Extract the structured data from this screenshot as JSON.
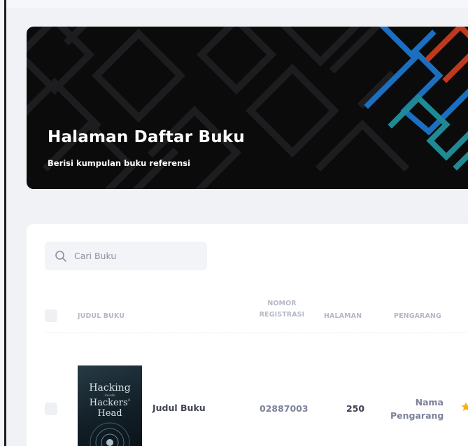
{
  "hero": {
    "title": "Halaman Daftar Buku",
    "subtitle": "Berisi kumpulan buku referensi",
    "accent_colors": [
      "#1c6fc0",
      "#c0391c",
      "#1f8a95"
    ]
  },
  "search": {
    "placeholder": "Cari Buku",
    "value": ""
  },
  "table": {
    "headers": {
      "title": "JUDUL BUKU",
      "registration_line1": "NOMOR",
      "registration_line2": "REGISTRASI",
      "pages": "HALAMAN",
      "author": "PENGARANG"
    },
    "rows": [
      {
        "cover_line1": "Hacking",
        "cover_line2": "Hackers' Head",
        "cover_small": "inside",
        "title": "Judul Buku",
        "registration": "02887003",
        "pages": "250",
        "author_line1": "Nama",
        "author_line2": "Pengarang",
        "rating_icon": "star-icon",
        "rating_color": "#ffad0f"
      }
    ]
  }
}
